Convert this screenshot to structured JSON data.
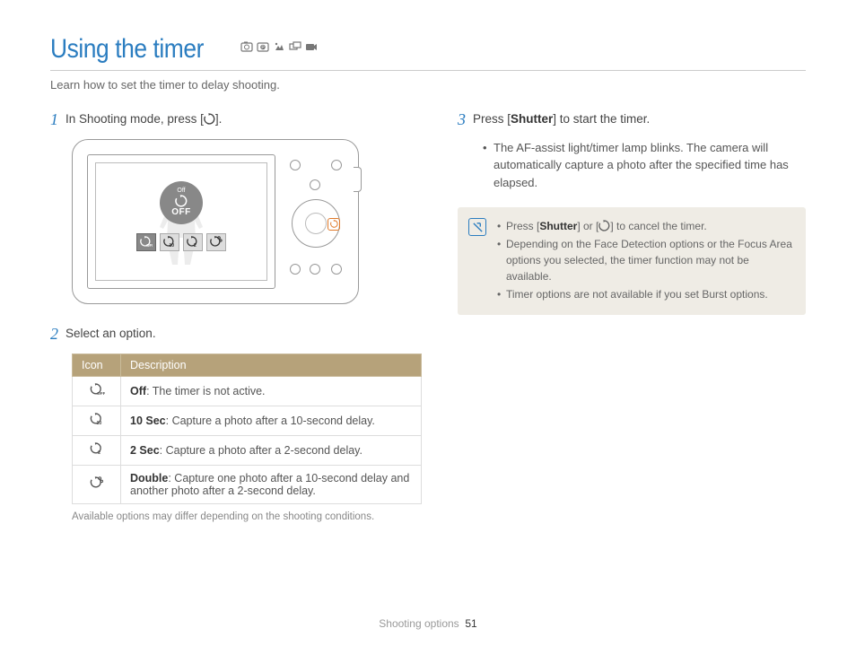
{
  "title": "Using the timer",
  "subtitle": "Learn how to set the timer to delay shooting.",
  "steps": {
    "s1": {
      "num": "1",
      "pre": "In Shooting mode, press [",
      "post": "]."
    },
    "s2": {
      "num": "2",
      "text": "Select an option."
    },
    "s3": {
      "num": "3",
      "pre": "Press [",
      "btn": "Shutter",
      "post": "] to start the timer."
    }
  },
  "camera": {
    "off_small": "Off",
    "off_big": "OFF"
  },
  "table": {
    "h1": "Icon",
    "h2": "Description",
    "rows": [
      {
        "b": "Off",
        "t": ": The timer is not active."
      },
      {
        "b": "10 Sec",
        "t": ": Capture a photo after a 10-second delay."
      },
      {
        "b": "2 Sec",
        "t": ": Capture a photo after a 2-second delay."
      },
      {
        "b": "Double",
        "t": ": Capture one photo after a 10-second delay and another photo after a 2-second delay."
      }
    ]
  },
  "caption": "Available options may differ depending on the shooting conditions.",
  "step3_bullet": "The AF-assist light/timer lamp blinks. The camera will automatically capture a photo after the specified time has elapsed.",
  "notes": {
    "n1a": "Press [",
    "n1b": "Shutter",
    "n1c": "] or [",
    "n1d": "] to cancel the timer.",
    "n2": "Depending on the Face Detection options or the Focus Area options you selected, the timer function may not be available.",
    "n3": "Timer options are not available if you set Burst options."
  },
  "footer": {
    "section": "Shooting options",
    "page": "51"
  }
}
